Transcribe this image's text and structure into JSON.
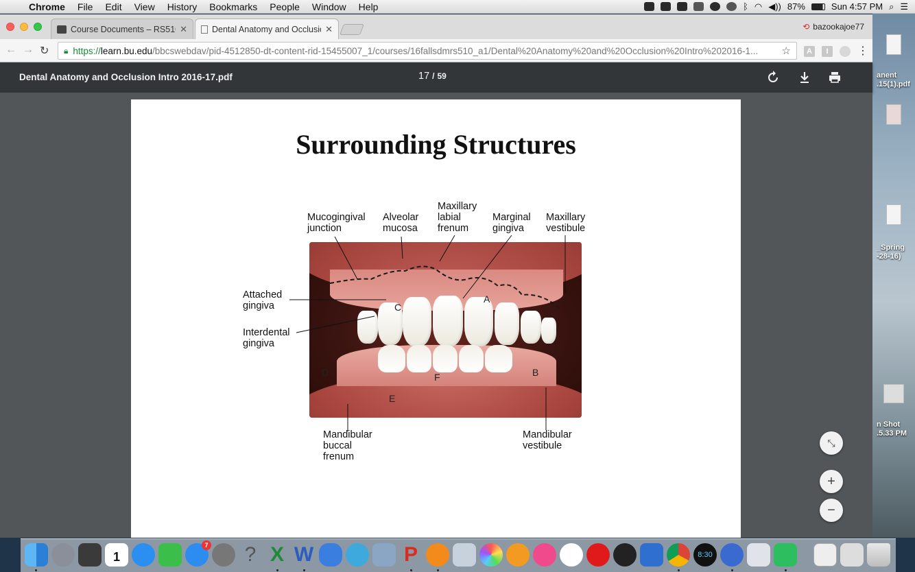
{
  "menubar": {
    "app": "Chrome",
    "items": [
      "File",
      "Edit",
      "View",
      "History",
      "Bookmarks",
      "People",
      "Window",
      "Help"
    ],
    "battery": "87%",
    "clock": "Sun 4:57 PM"
  },
  "tabs": [
    {
      "title": "Course Documents – RS510 A",
      "active": false
    },
    {
      "title": "Dental Anatomy and Occlusion",
      "active": true
    }
  ],
  "profile": "bazookajoe77",
  "address": {
    "scheme": "https://",
    "host": "learn.bu.edu",
    "path": "/bbcswebdav/pid-4512850-dt-content-rid-15455007_1/courses/16fallsdmrs510_a1/Dental%20Anatomy%20and%20Occlusion%20Intro%202016-1..."
  },
  "pdf": {
    "filename": "Dental Anatomy and Occlusion Intro 2016-17.pdf",
    "current_page": "17",
    "separator": "/",
    "total_pages": "59"
  },
  "slide": {
    "title": "Surrounding Structures",
    "labels": {
      "mucogingival": [
        "Mucogingival",
        "junction"
      ],
      "alveolar": [
        "Alveolar",
        "mucosa"
      ],
      "frenum": [
        "Maxillary",
        "labial",
        "frenum"
      ],
      "marginal": [
        "Marginal",
        "gingiva"
      ],
      "vestibule_max": [
        "Maxillary",
        "vestibule"
      ],
      "attached": [
        "Attached",
        "gingiva"
      ],
      "interdental": [
        "Interdental",
        "gingiva"
      ],
      "mand_buccal": [
        "Mandibular",
        "buccal",
        "frenum"
      ],
      "mand_vestibule": [
        "Mandibular",
        "vestibule"
      ]
    },
    "letters": {
      "a": "A",
      "b": "B",
      "c": "C",
      "d": "D",
      "e": "E",
      "f": "F"
    }
  },
  "desktop": {
    "labels": [
      "anent",
      ".15(1).pdf",
      "_Spring",
      "-28-16)",
      "n Shot",
      ".5.33 PM"
    ]
  },
  "dock": {
    "badge": "7",
    "calendar_day": "1",
    "calendar_month": "JAN",
    "clock": "8:30"
  },
  "colors": {
    "pdf_toolbar": "#323639",
    "viewer_bg": "#525659",
    "secure": "#1a8a36"
  }
}
